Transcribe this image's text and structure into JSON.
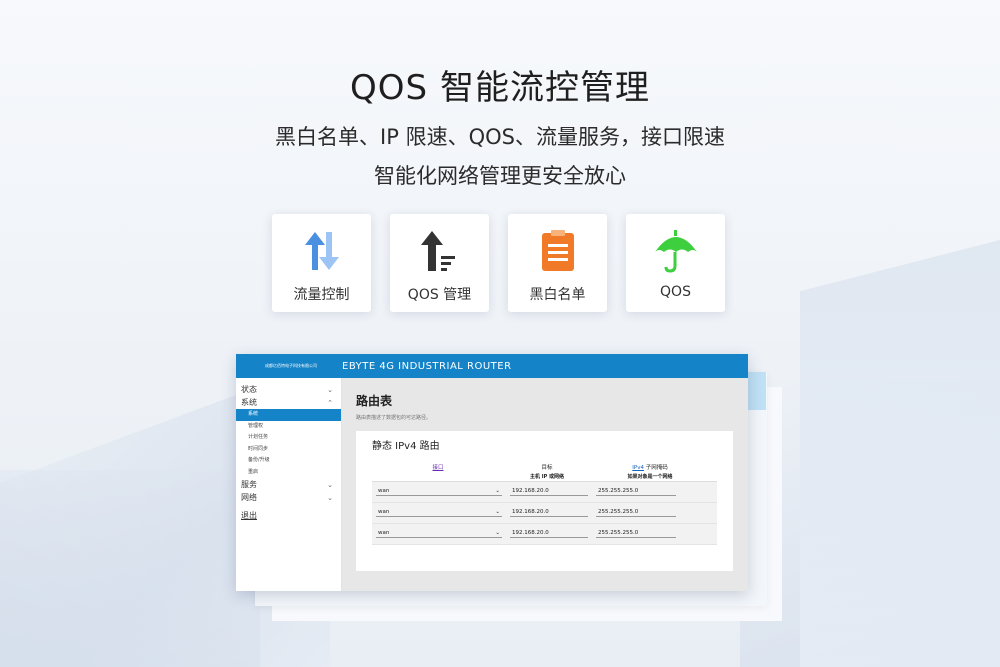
{
  "headline": "QOS 智能流控管理",
  "subtitle_line1": "黑白名单、IP 限速、QOS、流量服务，接口限速",
  "subtitle_line2": "智能化网络管理更安全放心",
  "features": [
    {
      "icon": "up-down-arrows-icon",
      "label": "流量控制",
      "color": "#4a8fe0"
    },
    {
      "icon": "upload-arrow-list-icon",
      "label": "QOS 管理",
      "color": "#333333"
    },
    {
      "icon": "clipboard-list-icon",
      "label": "黑白名单",
      "color": "#f07a28"
    },
    {
      "icon": "umbrella-icon",
      "label": "QOS",
      "color": "#3ecf3e"
    }
  ],
  "router": {
    "company": "成都亿佰特电子科技有限公司",
    "app_title": "EBYTE 4G INDUSTRIAL ROUTER",
    "accent": "#1483c8",
    "sidebar": {
      "status": "状态",
      "system": "系统",
      "system_items": [
        "系统",
        "管理权",
        "计划任务",
        "时间同步",
        "备份/升级",
        "重启"
      ],
      "services": "服务",
      "network": "网络",
      "logout": "退出"
    },
    "page_title": "路由表",
    "page_desc": "路由表描述了数据包的可达路径。",
    "section_title": "静态 IPv4 路由",
    "table": {
      "col_interface": "接口",
      "col_target": "目标",
      "col_netmask_link": "IPv4",
      "col_netmask_rest": " 子网掩码",
      "sub_target": "主机 IP 或网络",
      "sub_netmask": "如果对象是一个网络",
      "rows": [
        {
          "interface": "wan",
          "target": "192.168.20.0",
          "netmask": "255.255.255.0"
        },
        {
          "interface": "wan",
          "target": "192.168.20.0",
          "netmask": "255.255.255.0"
        },
        {
          "interface": "wan",
          "target": "192.168.20.0",
          "netmask": "255.255.255.0"
        }
      ]
    }
  }
}
